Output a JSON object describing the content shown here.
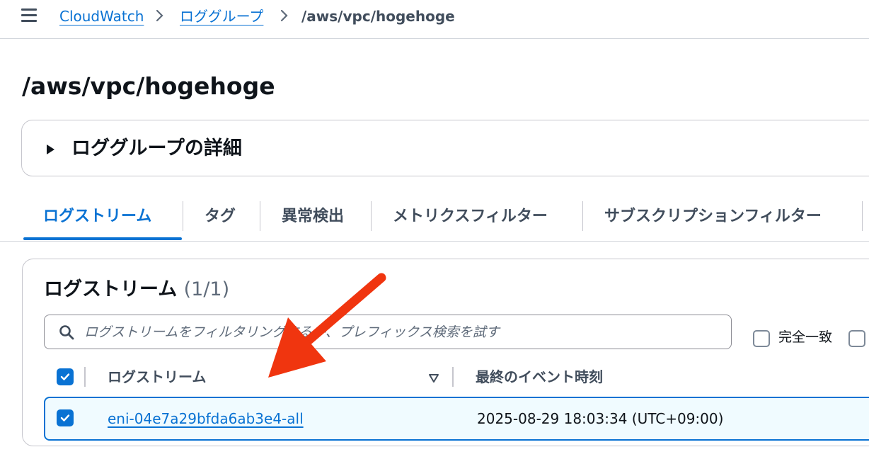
{
  "breadcrumb": {
    "items": [
      {
        "label": "CloudWatch"
      },
      {
        "label": "ロググループ"
      },
      {
        "label": "/aws/vpc/hogehoge"
      }
    ]
  },
  "page": {
    "title": "/aws/vpc/hogehoge"
  },
  "details": {
    "title": "ロググループの詳細",
    "expanded": false
  },
  "tabs": [
    {
      "label": "ログストリーム",
      "active": true
    },
    {
      "label": "タグ",
      "active": false
    },
    {
      "label": "異常検出",
      "active": false
    },
    {
      "label": "メトリクスフィルター",
      "active": false
    },
    {
      "label": "サブスクリプションフィルター",
      "active": false
    }
  ],
  "streams": {
    "title": "ログストリーム",
    "count": "(1/1)",
    "search_placeholder": "ログストリームをフィルタリングするか、プレフィックス検索を試す",
    "search_value": "",
    "exact_match_label": "完全一致",
    "exact_match_checked": false,
    "columns": [
      "ログストリーム",
      "最終のイベント時刻"
    ],
    "select_all_checked": true,
    "rows": [
      {
        "name": "eni-04e7a29bfda6ab3e4-all",
        "last_event": "2025-08-29 18:03:34 (UTC+09:00)",
        "selected": true
      }
    ]
  },
  "colors": {
    "accent": "#0972d3",
    "annotation_arrow": "#f0350f",
    "selected_row_bg": "#f0fbff"
  },
  "icons": [
    "menu-icon",
    "chevron-right-icon",
    "caret-right-icon",
    "search-icon",
    "checkbox-icon",
    "sort-down-icon",
    "annotation-arrow"
  ]
}
